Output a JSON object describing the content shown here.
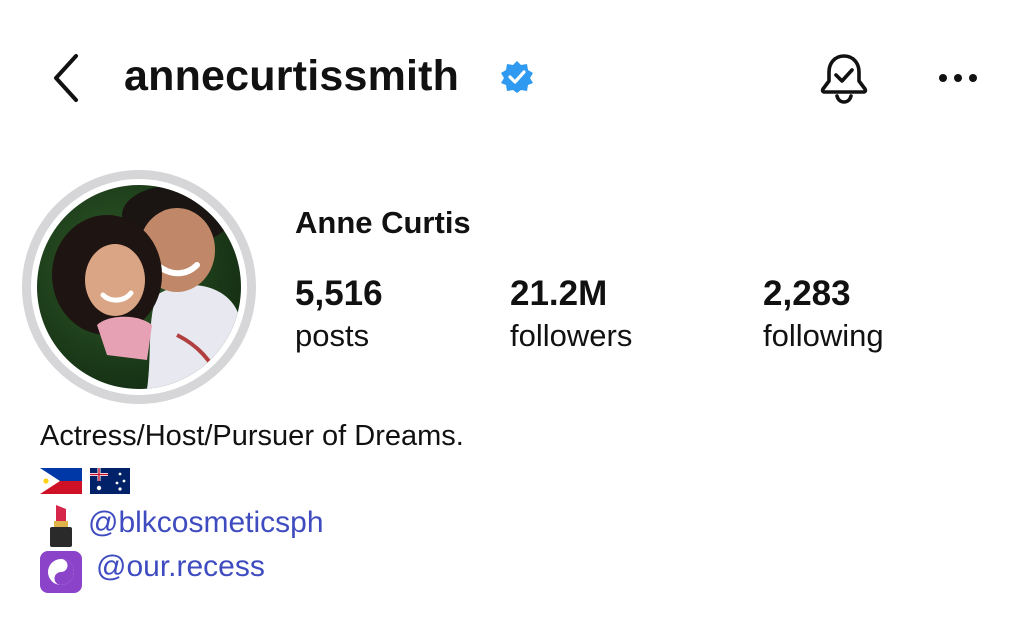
{
  "header": {
    "username": "annecurtissmith",
    "verified": true,
    "icons": {
      "back": "back-chevron-icon",
      "verified": "verified-badge-icon",
      "notifications": "bell-check-icon",
      "more": "more-dots-icon"
    }
  },
  "profile": {
    "display_name": "Anne Curtis",
    "stats": {
      "posts": {
        "value": "5,516",
        "label": "posts"
      },
      "followers": {
        "value": "21.2M",
        "label": "followers"
      },
      "following": {
        "value": "2,283",
        "label": "following"
      }
    }
  },
  "bio": {
    "text": "Actress/Host/Pursuer of Dreams.",
    "flags": [
      "flag-philippines-icon",
      "flag-australia-icon"
    ],
    "links": [
      {
        "icon": "lipstick-icon",
        "text": "@blkcosmeticsph"
      },
      {
        "icon": "yin-yang-icon",
        "text": "@our.recess"
      }
    ]
  },
  "colors": {
    "link": "#3f4cc0",
    "verified_badge": "#2f9af0",
    "avatar_ring": "#d6d6d8",
    "text": "#111111"
  }
}
